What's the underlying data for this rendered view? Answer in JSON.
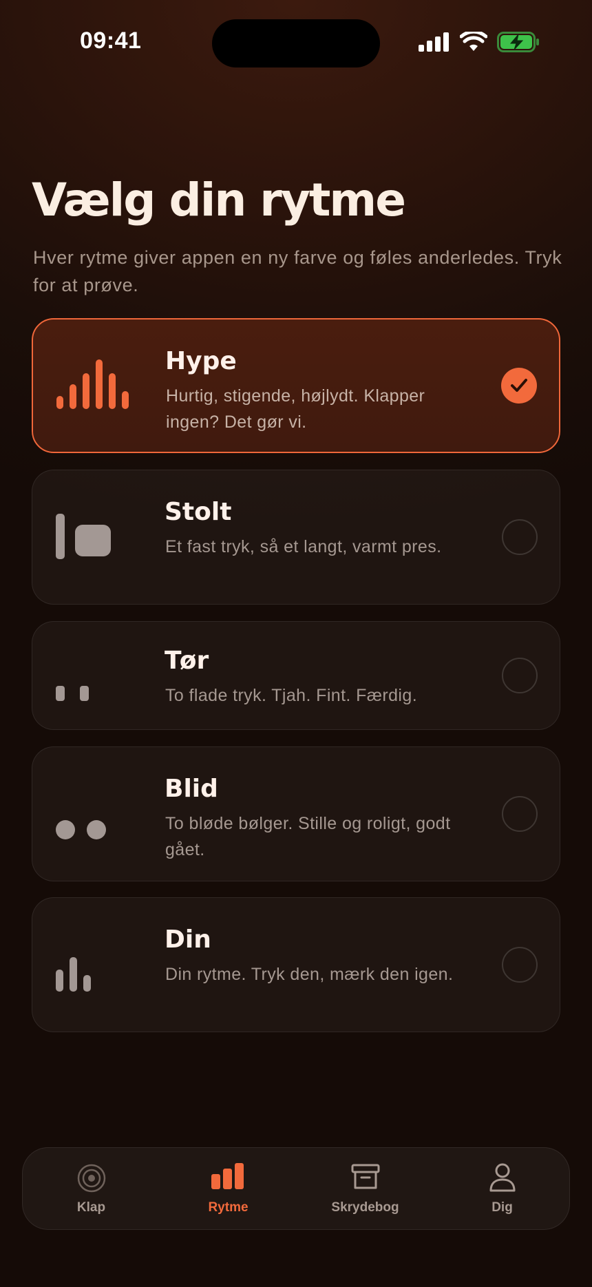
{
  "status": {
    "time": "09:41"
  },
  "header": {
    "title": "Vælg din rytme",
    "subtitle": "Hver rytme giver appen en ny farve og føles anderledes. Tryk for at prøve."
  },
  "rhythms": [
    {
      "title": "Hype",
      "description": "Hurtig, stigende, højlydt. Klapper ingen? Det gør vi.",
      "selected": true,
      "icon": "rising-bars-icon"
    },
    {
      "title": "Stolt",
      "description": "Et fast tryk, så et langt, varmt pres.",
      "selected": false,
      "icon": "bar-and-block-icon"
    },
    {
      "title": "Tør",
      "description": "To flade tryk. Tjah. Fint. Færdig.",
      "selected": false,
      "icon": "two-flat-marks-icon"
    },
    {
      "title": "Blid",
      "description": "To bløde bølger. Stille og roligt, godt gået.",
      "selected": false,
      "icon": "two-dots-icon"
    },
    {
      "title": "Din",
      "description": "Din rytme. Tryk den, mærk den igen.",
      "selected": false,
      "icon": "three-bars-icon"
    }
  ],
  "tabs": [
    {
      "label": "Klap",
      "icon": "target-icon",
      "active": false
    },
    {
      "label": "Rytme",
      "icon": "bars-icon",
      "active": true
    },
    {
      "label": "Skrydebog",
      "icon": "archive-box-icon",
      "active": false
    },
    {
      "label": "Dig",
      "icon": "person-icon",
      "active": false
    }
  ],
  "colors": {
    "accent": "#f26a3c",
    "background": "#1b0e09",
    "title_text": "#fbeee2"
  }
}
